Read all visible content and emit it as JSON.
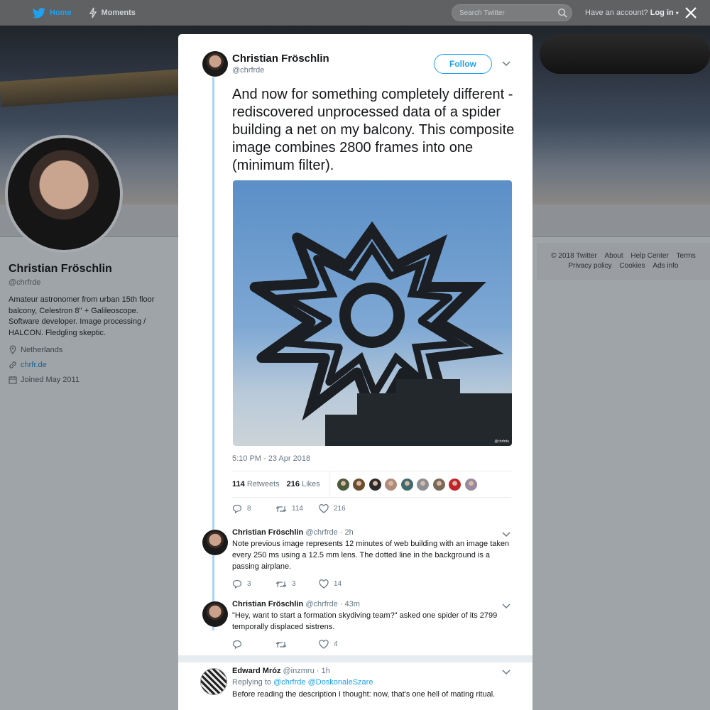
{
  "nav": {
    "home": "Home",
    "moments": "Moments",
    "search_placeholder": "Search Twitter",
    "account_prompt": "Have an account?",
    "login": "Log in"
  },
  "profile": {
    "name": "Christian Fröschlin",
    "handle": "@chrfrde",
    "bio": "Amateur astronomer from urban 15th floor balcony, Celestron 8'' + Galileoscope. Software developer. Image processing / HALCON. Fledgling skeptic.",
    "location": "Netherlands",
    "website": "chrfr.de",
    "joined": "Joined May 2011"
  },
  "footer": {
    "links_row1": [
      "© 2018 Twitter",
      "About",
      "Help Center",
      "Terms"
    ],
    "links_row2": [
      "Privacy policy",
      "Cookies",
      "Ads info"
    ]
  },
  "tweet": {
    "author_name": "Christian Fröschlin",
    "author_handle": "@chrfrde",
    "follow_label": "Follow",
    "text": "And now for something completely different - rediscovered unprocessed data of a spider building a net on my balcony. This composite image combines 2800 frames into one (minimum filter).",
    "media_watermark": "@chrfrde",
    "timestamp": "5:10 PM - 23 Apr 2018",
    "retweets_count": "114",
    "retweets_label": "Retweets",
    "likes_count": "216",
    "likes_label": "Likes",
    "likers_colors": [
      "#4a5a3a",
      "#6b4e2e",
      "#2b2b2b",
      "#b08d7a",
      "#3f6b6e",
      "#8a8f94",
      "#7a6a5a",
      "#c0242a",
      "#9a8aa0"
    ],
    "actions": {
      "replies": "8",
      "retweets": "114",
      "likes": "216"
    }
  },
  "replies": [
    {
      "name": "Christian Fröschlin",
      "handle": "@chrfrde",
      "time": "· 2h",
      "text": "Note previous image represents 12 minutes of web building with an image taken every 250 ms using a 12.5 mm lens. The dotted line in the background is a passing airplane.",
      "actions": {
        "replies": "3",
        "retweets": "3",
        "likes": "14"
      }
    },
    {
      "name": "Christian Fröschlin",
      "handle": "@chrfrde",
      "time": "· 43m",
      "text": "\"Hey, want to start a formation skydiving team?\" asked one spider of its 2799 temporally displaced sistrens.",
      "actions": {
        "replies": "",
        "retweets": "",
        "likes": "4"
      }
    },
    {
      "name": "Edward Mróz",
      "handle": "@inzmru",
      "time": "· 1h",
      "replying_prefix": "Replying to",
      "replying_to": [
        "@chrfrde",
        "@DoskonaleSzare"
      ],
      "text": "Before reading the description I thought: now, that's one hell of mating ritual."
    }
  ]
}
